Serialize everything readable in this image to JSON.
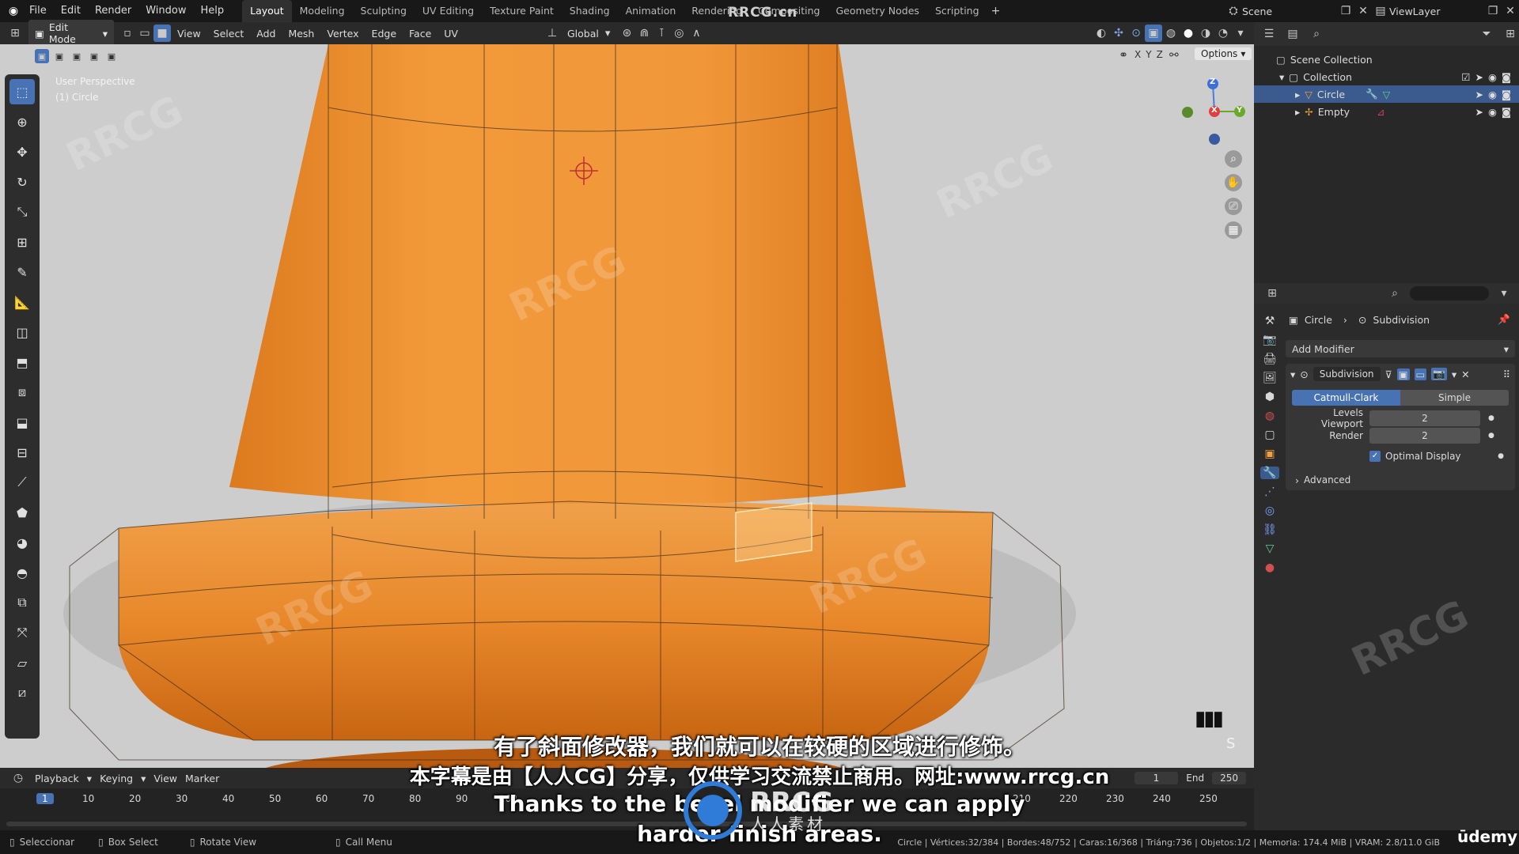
{
  "topbar": {
    "menus": [
      "File",
      "Edit",
      "Render",
      "Window",
      "Help"
    ],
    "workspaces": [
      "Layout",
      "Modeling",
      "Sculpting",
      "UV Editing",
      "Texture Paint",
      "Shading",
      "Animation",
      "Rendering",
      "Compositing",
      "Geometry Nodes",
      "Scripting"
    ],
    "active_workspace": "Layout",
    "watermark_center": "RRCG.cn",
    "scene": "Scene",
    "view_layer": "ViewLayer"
  },
  "header": {
    "mode": "Edit Mode",
    "menus": [
      "View",
      "Select",
      "Add",
      "Mesh",
      "Vertex",
      "Edge",
      "Face",
      "UV"
    ],
    "transform": "Global",
    "options": "Options",
    "axes": [
      "X",
      "Y",
      "Z"
    ]
  },
  "viewport": {
    "perspective": "User Perspective",
    "object": "(1) Circle",
    "gizmo": {
      "z": "Z",
      "x": "X",
      "y": "Y"
    }
  },
  "outliner": {
    "scene_collection": "Scene Collection",
    "collection": "Collection",
    "items": [
      "Circle",
      "Empty"
    ]
  },
  "properties": {
    "breadcrumb_object": "Circle",
    "breadcrumb_modifier": "Subdivision",
    "add_modifier": "Add Modifier",
    "modifier_name": "Subdivision",
    "catmull": "Catmull-Clark",
    "simple": "Simple",
    "levels_label": "Levels Viewport",
    "levels_value": "2",
    "render_label": "Render",
    "render_value": "2",
    "optimal": "Optimal Display",
    "advanced": "Advanced"
  },
  "timeline": {
    "menus": [
      "Playback",
      "Keying",
      "View",
      "Marker"
    ],
    "current_frame": "1",
    "start_frame": "1",
    "end_label": "End",
    "end_frame": "250",
    "ticks": [
      "1",
      "10",
      "20",
      "30",
      "40",
      "50",
      "60",
      "70",
      "80",
      "90",
      "100",
      "210",
      "220",
      "230",
      "240",
      "250"
    ]
  },
  "status": {
    "select": "Seleccionar",
    "box": "Box Select",
    "rotate": "Rotate View",
    "menu": "Call Menu",
    "stats": "Circle | Vértices:32/384 | Bordes:48/752 | Caras:16/368 | Triáng:736 | Objetos:1/2 | Memoria: 174.4 MiB | VRAM: 2.8/11.0 GiB"
  },
  "subtitles": {
    "line1": "有了斜面修改器，我们就可以在较硬的区域进行修饰。",
    "line2": "本字幕是由【人人CG】分享，仅供学习交流禁止商用。网址:www.rrcg.cn",
    "line3": "Thanks to the bevel modifier we can apply",
    "line4": "harder finish areas."
  },
  "brand": {
    "udemy": "ūdemy",
    "rrcg": "RRCG",
    "rrcg_cn": "人人素材"
  },
  "colors": {
    "accent": "#4772b3",
    "mesh": "#e88a2a",
    "bg": "#cdcdcd"
  }
}
